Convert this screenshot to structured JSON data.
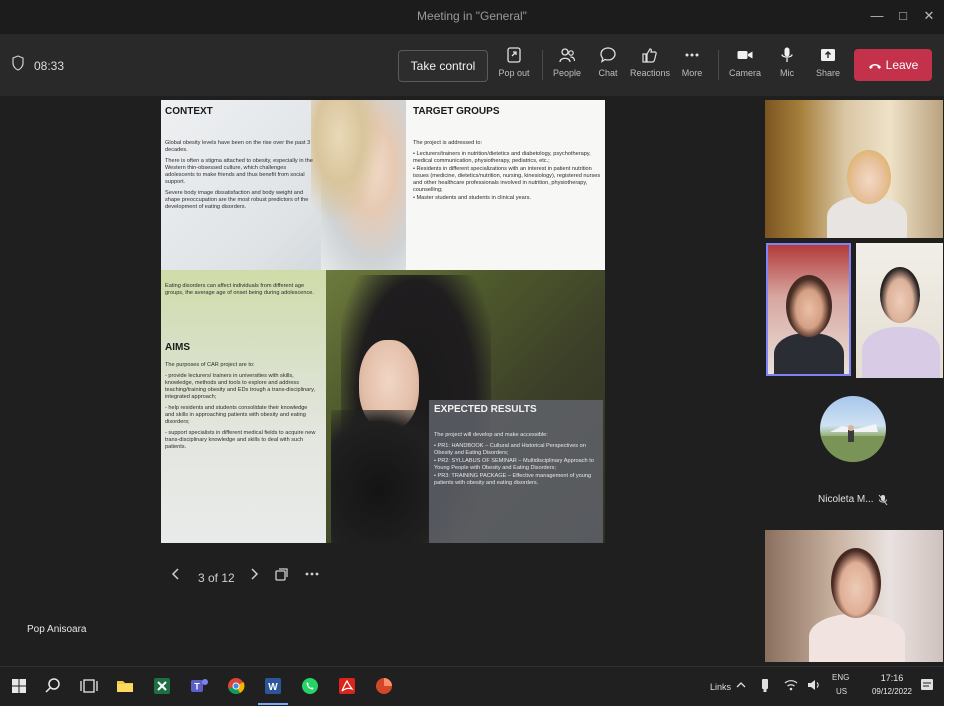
{
  "window": {
    "title": "Meeting in \"General\""
  },
  "toolbar": {
    "timer": "08:33",
    "take_control": "Take control",
    "buttons": [
      {
        "label": "Pop out",
        "icon": "pop-out-icon"
      },
      {
        "label": "People",
        "icon": "people-icon"
      },
      {
        "label": "Chat",
        "icon": "chat-icon"
      },
      {
        "label": "Reactions",
        "icon": "reactions-icon"
      },
      {
        "label": "More",
        "icon": "more-icon"
      },
      {
        "label": "Camera",
        "icon": "camera-icon"
      },
      {
        "label": "Mic",
        "icon": "mic-icon"
      },
      {
        "label": "Share",
        "icon": "share-icon"
      }
    ],
    "leave": "Leave",
    "leave_color": "#c4314b"
  },
  "slide": {
    "context": {
      "title": "CONTEXT",
      "paragraphs": [
        "Global obesity levels have been on the rise over the past 3 decades.",
        "There is often a stigma attached to obesity, especially in the Western thin-obsessed culture, which challenges adolescents to make friends and thus benefit from social support.",
        "Severe body image dissatisfaction and body weight and shape preoccupation are the most robust predictors of the development of eating disorders.",
        "Eating disorders can affect individuals from different age groups, the average age of onset being during adolescence."
      ]
    },
    "target_groups": {
      "title": "TARGET GROUPS",
      "intro": "The project is addressed to:",
      "items": [
        "• Lecturers/trainers in nutrition/dietetics and diabetology, psychotherapy, medical communication, physiotherapy, pediatrics, etc.;",
        "• Residents in different specializations with an interest in patient nutrition issues (medicine, dietetics/nutrition, nursing, kinesiology), registered nurses and other healthcare professionals involved in nutrition, physiotherapy, counselling;",
        "• Master students and students in clinical years."
      ]
    },
    "aims": {
      "title": "AIMS",
      "intro": "The purposes of CAR project are to:",
      "items": [
        "- provide lecturers/ trainers in universities with skills, knowledge, methods and tools to explore and address teaching/training obesity and EDs trough a trans-disciplinary, integrated approach;",
        "- help residents and students consolidate their knowledge and skills in approaching patients with obesity and eating disorders;",
        "- support specialists in different medical fields to acquire new trans-disciplinary knowledge and skills to deal with such patients."
      ]
    },
    "expected_results": {
      "title": "EXPECTED RESULTS",
      "intro": "The project will develop and make accessible:",
      "items": [
        "• PR1: HANDBOOK – Cultural and Historical Perspectives on Obesity and Eating Disorders;",
        "• PR2: SYLLABUS OF SEMINAR – Multidisciplinary Approach to Young People with Obesity and Eating Disorders;",
        "• PR3: TRAINING PACKAGE – Effective management of young patients with obesity and eating disorders."
      ]
    }
  },
  "slide_nav": {
    "page": "3 of 12"
  },
  "participants": {
    "avatar_name": "Nicoleta M...",
    "presenter": "Pop Anisoara"
  },
  "taskbar": {
    "links": "Links",
    "lang": "ENG",
    "region": "US",
    "time": "17:16",
    "date": "09/12/2022"
  }
}
